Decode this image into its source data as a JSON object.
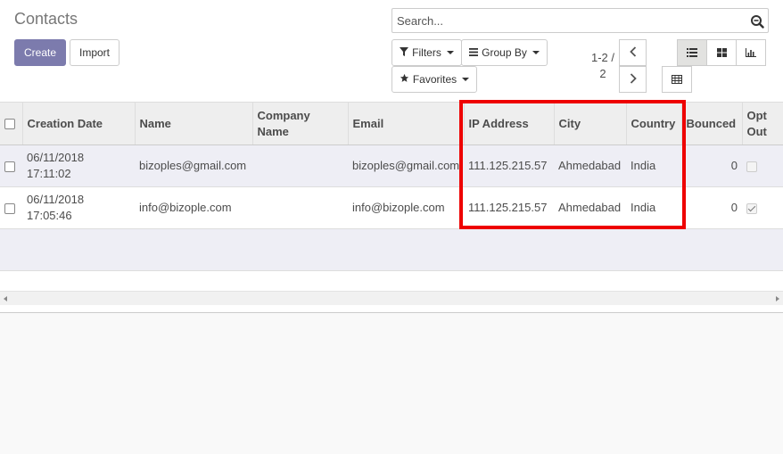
{
  "page": {
    "title": "Contacts"
  },
  "buttons": {
    "create": "Create",
    "import": "Import"
  },
  "search": {
    "placeholder": "Search..."
  },
  "filters": {
    "filters": "Filters",
    "group_by": "Group By",
    "favorites": "Favorites"
  },
  "pager": {
    "range": "1-2 /",
    "total": "2"
  },
  "table": {
    "columns": {
      "creation_date": "Creation Date",
      "name": "Name",
      "company_name": "Company Name",
      "email": "Email",
      "ip_address": "IP Address",
      "city": "City",
      "country": "Country",
      "bounced": "Bounced",
      "opt_out": "Opt Out"
    },
    "rows": [
      {
        "date": "06/11/2018",
        "time": "17:11:02",
        "name": "bizoples@gmail.com",
        "company": "",
        "email": "bizoples@gmail.com",
        "ip": "111.125.215.57",
        "city": "Ahmedabad",
        "country": "India",
        "bounced": "0",
        "opt_out": false
      },
      {
        "date": "06/11/2018",
        "time": "17:05:46",
        "name": "info@bizople.com",
        "company": "",
        "email": "info@bizople.com",
        "ip": "111.125.215.57",
        "city": "Ahmedabad",
        "country": "India",
        "bounced": "0",
        "opt_out": true
      }
    ]
  },
  "colors": {
    "primary": "#7c7bad",
    "highlight": "#ee0000"
  }
}
